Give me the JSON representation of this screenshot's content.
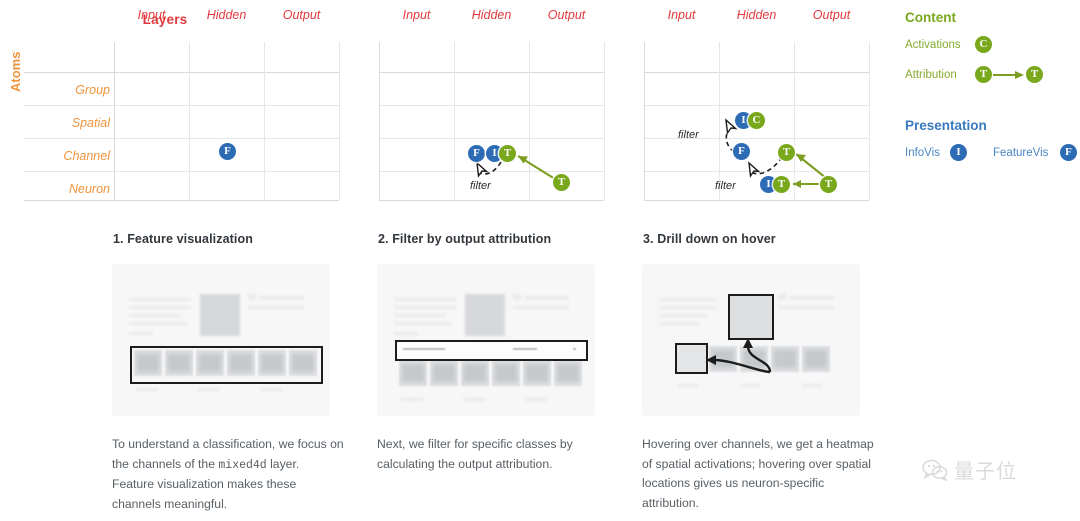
{
  "matrix": {
    "title": "Layers",
    "axis_label": "Atoms",
    "columns": [
      "Input",
      "Hidden",
      "Output"
    ],
    "rows": [
      "Group",
      "Spatial",
      "Channel",
      "Neuron"
    ],
    "filter_label": "filter",
    "instances": [
      {
        "id": "matrix-1",
        "badges": [
          {
            "letter": "F",
            "color": "blue",
            "row": "Channel",
            "col": "Hidden"
          }
        ],
        "filters": [],
        "arrows": []
      },
      {
        "id": "matrix-2",
        "badges": [
          {
            "letter": "F",
            "color": "blue",
            "row": "Channel",
            "col": "Hidden"
          },
          {
            "letter": "I",
            "color": "blue",
            "row": "Channel",
            "col": "Hidden"
          },
          {
            "letter": "T",
            "color": "olive",
            "row": "Channel",
            "col": "Hidden"
          },
          {
            "letter": "T",
            "color": "olive",
            "row": "Neuron",
            "col": "Output"
          }
        ],
        "filters": [
          {
            "label": "filter"
          }
        ],
        "arrows": [
          {
            "from": "T-output-neuron",
            "to": "T-hidden-channel"
          }
        ]
      },
      {
        "id": "matrix-3",
        "badges": [
          {
            "letter": "I",
            "color": "blue",
            "row": "Spatial",
            "col": "Hidden"
          },
          {
            "letter": "C",
            "color": "olive",
            "row": "Spatial",
            "col": "Hidden"
          },
          {
            "letter": "F",
            "color": "blue",
            "row": "Channel",
            "col": "Hidden"
          },
          {
            "letter": "T",
            "color": "olive",
            "row": "Channel",
            "col": "Output"
          },
          {
            "letter": "I",
            "color": "blue",
            "row": "Neuron",
            "col": "Output"
          },
          {
            "letter": "T",
            "color": "olive",
            "row": "Neuron",
            "col": "Output"
          }
        ],
        "filters": [
          {
            "label": "filter"
          },
          {
            "label": "filter"
          }
        ],
        "arrows": [
          {
            "from": "T-output-neuron",
            "to": "T-output-channel"
          },
          {
            "from": "T-output-neuron",
            "to": "IT-output-neuron"
          }
        ]
      }
    ]
  },
  "legend": {
    "content": {
      "heading": "Content",
      "items": [
        {
          "label": "Activations",
          "badge": "C",
          "color": "olive",
          "type": "badge"
        },
        {
          "label": "Attribution",
          "badge": "T",
          "color": "olive",
          "type": "arrow"
        }
      ]
    },
    "presentation": {
      "heading": "Presentation",
      "items": [
        {
          "label": "InfoVis",
          "badge": "I",
          "color": "blue"
        },
        {
          "label": "FeatureVis",
          "badge": "F",
          "color": "blue"
        }
      ]
    }
  },
  "steps": [
    {
      "heading": "1. Feature visualization",
      "caption_a": "To understand a classification, we focus on the channels of the ",
      "caption_mono": "mixed4d",
      "caption_b": " layer. Feature visualization makes these channels meaningful."
    },
    {
      "heading": "2. Filter by output attribution",
      "caption_a": "Next, we filter for specific classes by calculating the output attribution.",
      "caption_mono": "",
      "caption_b": ""
    },
    {
      "heading": "3. Drill down on hover",
      "caption_a": "Hovering over channels, we get a heatmap of spatial activations; hovering over spatial locations gives us neuron-specific attribution.",
      "caption_mono": "",
      "caption_b": ""
    }
  ],
  "watermark": {
    "text": "量子位",
    "icon": "wechat-icon"
  },
  "colors": {
    "title_red": "#e03a3e",
    "column_red": "#e0393d",
    "row_orange": "#f0943c",
    "badge_blue": "#2d6cb5",
    "badge_olive": "#7aa81c",
    "content_green": "#7aa81c",
    "presentation_blue": "#3a7bbf",
    "heading_dark": "#31373c",
    "caption_gray": "#585f65"
  }
}
